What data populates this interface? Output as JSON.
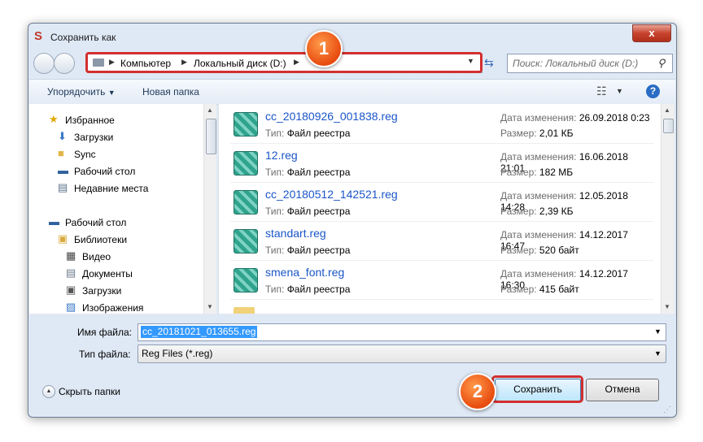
{
  "window": {
    "title": "Сохранить как",
    "close_glyph": "x"
  },
  "address": {
    "crumbs": [
      "Компьютер",
      "Локальный диск (D:)"
    ]
  },
  "search": {
    "placeholder": "Поиск: Локальный диск (D:)"
  },
  "toolbar": {
    "organize_label": "Упорядочить",
    "new_folder_label": "Новая папка",
    "help_glyph": "?"
  },
  "annotations": {
    "badge1": "1",
    "badge2": "2",
    "accent": "#d32f2f"
  },
  "nav": {
    "items": [
      {
        "label": "Избранное",
        "icon": "star-icon"
      },
      {
        "label": "Загрузки",
        "icon": "downloads-icon"
      },
      {
        "label": "Sync",
        "icon": "folder-icon"
      },
      {
        "label": "Рабочий стол",
        "icon": "desktop-icon"
      },
      {
        "label": "Недавние места",
        "icon": "recent-icon"
      },
      {
        "label": "Рабочий стол",
        "icon": "desktop-icon"
      },
      {
        "label": "Библиотеки",
        "icon": "libraries-icon"
      },
      {
        "label": "Видео",
        "icon": "video-icon"
      },
      {
        "label": "Документы",
        "icon": "documents-icon"
      },
      {
        "label": "Загрузки",
        "icon": "downloads-icon"
      },
      {
        "label": "Изображения",
        "icon": "pictures-icon"
      }
    ]
  },
  "files": {
    "type_key": "Тип:",
    "date_key": "Дата изменения:",
    "size_key": "Размер:",
    "items": [
      {
        "name": "cc_20180926_001838.reg",
        "type": "Файл реестра",
        "date": "26.09.2018 0:23",
        "size": "2,01 КБ"
      },
      {
        "name": "12.reg",
        "type": "Файл реестра",
        "date": "16.06.2018 21:01",
        "size": "182 МБ"
      },
      {
        "name": "cc_20180512_142521.reg",
        "type": "Файл реестра",
        "date": "12.05.2018 14:28",
        "size": "2,39 КБ"
      },
      {
        "name": "standart.reg",
        "type": "Файл реестра",
        "date": "14.12.2017 16:47",
        "size": "520 байт"
      },
      {
        "name": "smena_font.reg",
        "type": "Файл реестра",
        "date": "14.12.2017 16:30",
        "size": "415 байт"
      }
    ]
  },
  "form": {
    "filename_label": "Имя файла:",
    "filename_value": "cc_20181021_013655.reg",
    "filetype_label": "Тип файла:",
    "filetype_value": "Reg Files (*.reg)",
    "hide_folders_label": "Скрыть папки",
    "save_label": "Сохранить",
    "cancel_label": "Отмена"
  }
}
